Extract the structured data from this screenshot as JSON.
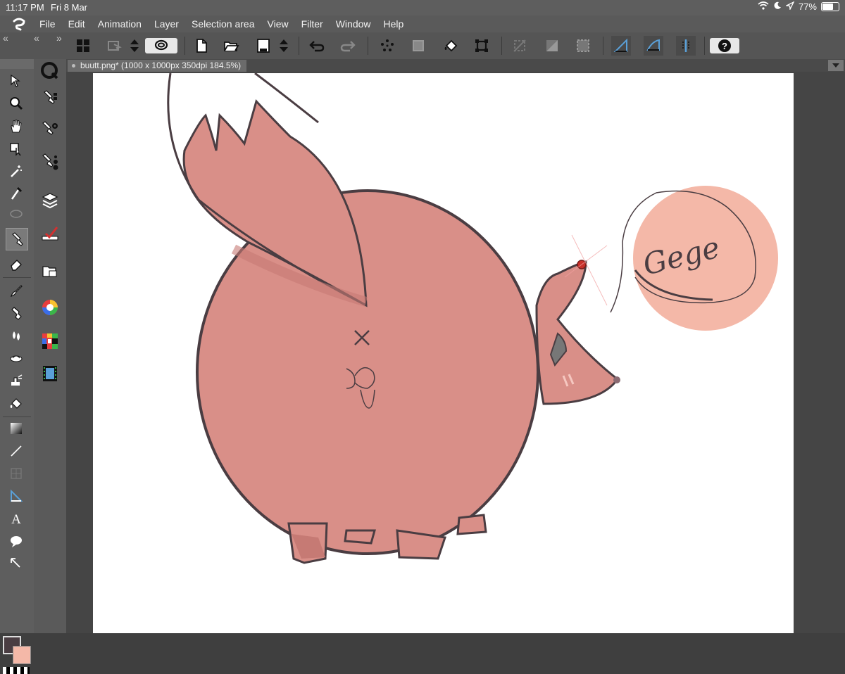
{
  "status": {
    "time": "11:17 PM",
    "date": "Fri 8 Mar",
    "battery": "77%",
    "battery_level": 0.77
  },
  "menu": [
    "File",
    "Edit",
    "Animation",
    "Layer",
    "Selection area",
    "View",
    "Filter",
    "Window",
    "Help"
  ],
  "document": {
    "tab_label": "buutt.png* (1000 x 1000px 350dpi 184.5%)"
  },
  "canvas": {
    "speech_text": "Gege"
  },
  "colors": {
    "main": "#4a3d42",
    "sub": "#f4b8a8",
    "accent": "#5aa0d8"
  },
  "toolbar_icons": [
    "grid-icon",
    "select-icon",
    "stepper-icon",
    "lasso-icon",
    "new-icon",
    "open-icon",
    "save-icon",
    "stepper2-icon",
    "undo-icon",
    "redo-icon",
    "dots-icon",
    "transform-icon",
    "fill-icon",
    "crop-icon",
    "deselect-icon",
    "invert-icon",
    "select-all-icon",
    "ruler-icon",
    "ruler2-icon",
    "snap-icon",
    "help-icon"
  ]
}
